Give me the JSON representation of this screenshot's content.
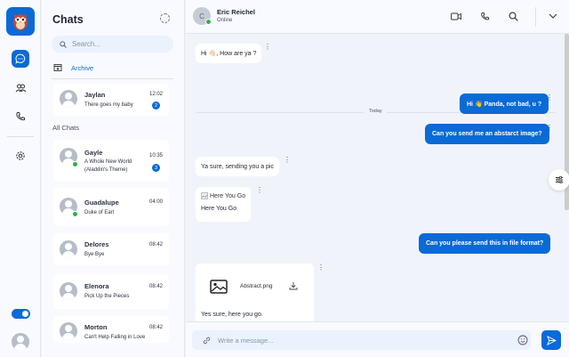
{
  "sidebar": {
    "nav": [
      "chat",
      "contacts",
      "calls",
      "settings"
    ]
  },
  "chat_list": {
    "title": "Chats",
    "search_placeholder": "Search...",
    "archive_label": "Archive",
    "pinned": [
      {
        "name": "Jaylan",
        "message": "There goes my baby",
        "time": "12:02",
        "unread": "2"
      }
    ],
    "all_label": "All Chats",
    "chats": [
      {
        "name": "Gayle",
        "message": "A Whole New World (Aladdin's Theme)",
        "time": "10:35",
        "unread": "3",
        "online": true
      },
      {
        "name": "Guadalupe",
        "message": "Duke of Earl",
        "time": "04:00",
        "online": true
      },
      {
        "name": "Delores",
        "message": "Bye Bye",
        "time": "08:42"
      },
      {
        "name": "Elenora",
        "message": "Pick Up the Pieces",
        "time": "08:42"
      },
      {
        "name": "Morton",
        "message": "Can't Help Falling in Love",
        "time": "08:42"
      }
    ]
  },
  "conversation": {
    "contact_initial": "C",
    "contact_name": "Eric Reichel",
    "status": "Online",
    "day_label": "Today",
    "messages": [
      {
        "text": "Hi 👋🏻, How are ya ?"
      },
      {
        "text": "Hi 👋 Panda, not bad, u ?"
      },
      {
        "text": "Can you send me an abstarct image?"
      },
      {
        "text": "Ya sure, sending you a pic"
      },
      {
        "image_alt": "Here You Go",
        "caption": "Here You Go"
      },
      {
        "text": "Can you please send this in file format?"
      },
      {
        "file_name": "Abstract.png",
        "caption": "Yes sure, here you go."
      }
    ],
    "composer_placeholder": "Write a message..."
  },
  "colors": {
    "accent": "#0a6ad6",
    "online": "#27b44a"
  }
}
